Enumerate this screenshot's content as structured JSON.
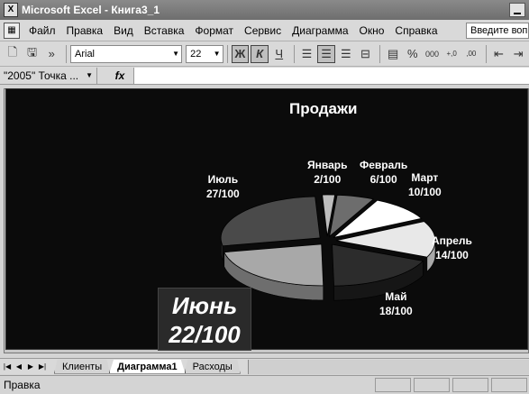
{
  "window": {
    "title": "Microsoft Excel - Книга3_1",
    "app_icon": "X"
  },
  "menu": {
    "items": [
      "Файл",
      "Правка",
      "Вид",
      "Вставка",
      "Формат",
      "Сервис",
      "Диаграмма",
      "Окно",
      "Справка"
    ],
    "help_placeholder": "Введите вопрос"
  },
  "toolbar": {
    "font": "Arial",
    "size": "22",
    "bold": "Ж",
    "italic": "К",
    "underline": "Ч",
    "overflow": "»",
    "misc_percent": "%",
    "misc_thousands": "000",
    "misc_inc_dec": "+,0",
    "misc_dec_dec": ",00"
  },
  "formula_bar": {
    "name_box": "\"2005\" Точка ...",
    "fx": "fx",
    "formula": ""
  },
  "chart_data": {
    "type": "pie",
    "title": "Продажи",
    "categories": [
      "Январь",
      "Февраль",
      "Март",
      "Апрель",
      "Май",
      "Июнь",
      "Июль"
    ],
    "values": [
      2,
      6,
      10,
      14,
      18,
      22,
      27
    ],
    "labels": [
      "2/100",
      "6/100",
      "10/100",
      "14/100",
      "18/100",
      "22/100",
      "27/100"
    ],
    "exploded": true,
    "three_d": true
  },
  "sheet_tabs": [
    "Клиенты",
    "Диаграмма1",
    "Расходы"
  ],
  "active_tab": "Диаграмма1",
  "status": "Правка"
}
